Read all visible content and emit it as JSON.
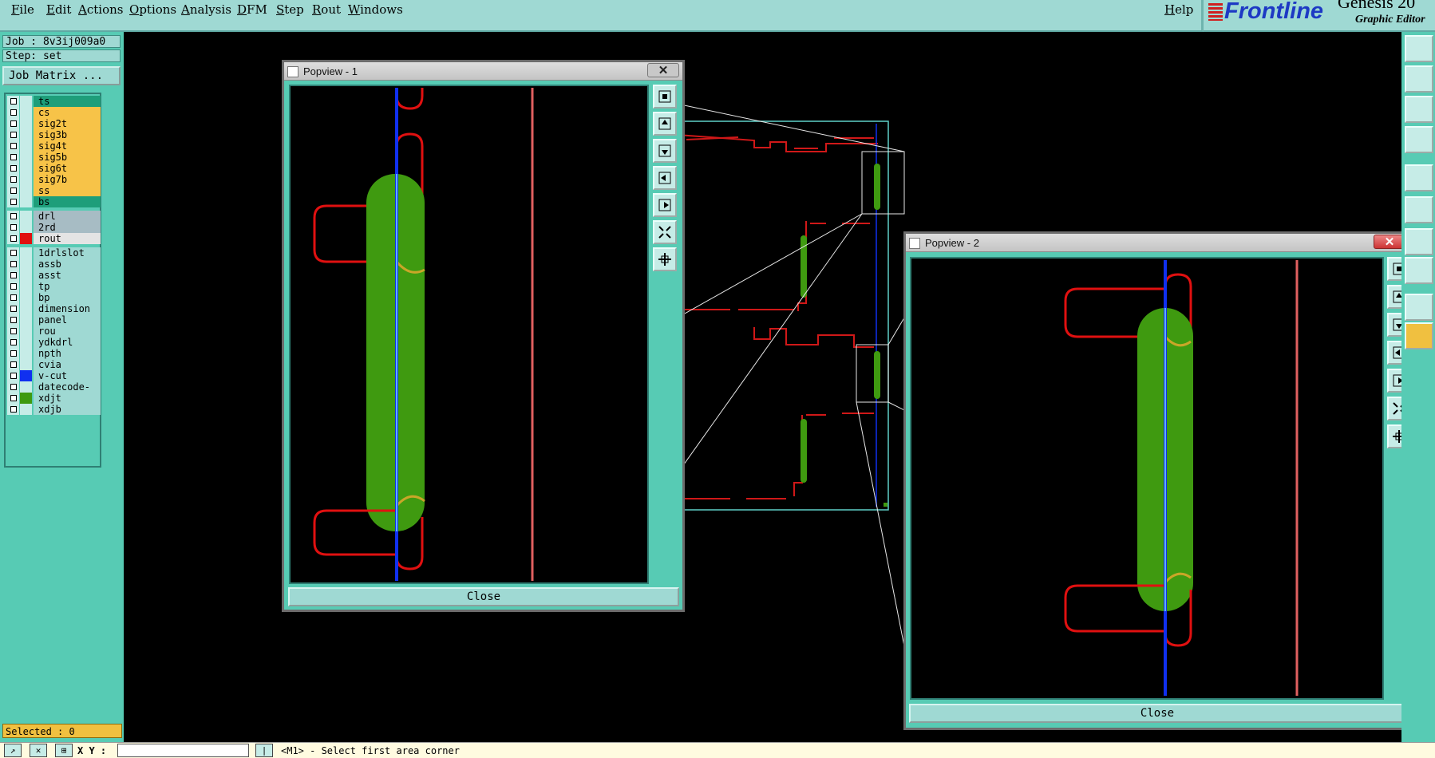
{
  "menubar": {
    "items": [
      "File",
      "Edit",
      "Actions",
      "Options",
      "Analysis",
      "DFM",
      "Step",
      "Rout",
      "Windows"
    ],
    "help": "Help"
  },
  "brand": {
    "logo": "Frontline",
    "product": "Genesis 20",
    "subtitle": "Graphic Editor"
  },
  "left": {
    "job": "Job : 8v3ij009a0",
    "step": "Step: set",
    "job_matrix": "Job Matrix ...",
    "layers": [
      {
        "name": "ts",
        "color": "#1e9e7a",
        "swatch": ""
      },
      {
        "name": "cs",
        "color": "#f7c348",
        "swatch": ""
      },
      {
        "name": "sig2t",
        "color": "#f7c348",
        "swatch": ""
      },
      {
        "name": "sig3b",
        "color": "#f7c348",
        "swatch": ""
      },
      {
        "name": "sig4t",
        "color": "#f7c348",
        "swatch": ""
      },
      {
        "name": "sig5b",
        "color": "#f7c348",
        "swatch": ""
      },
      {
        "name": "sig6t",
        "color": "#f7c348",
        "swatch": ""
      },
      {
        "name": "sig7b",
        "color": "#f7c348",
        "swatch": ""
      },
      {
        "name": "ss",
        "color": "#f7c348",
        "swatch": ""
      },
      {
        "name": "bs",
        "color": "#1e9e7a",
        "swatch": ""
      },
      {
        "name": "drl",
        "color": "#a7bcc4",
        "swatch": ""
      },
      {
        "name": "2rd",
        "color": "#a7bcc4",
        "swatch": ""
      },
      {
        "name": "rout",
        "color": "#e4e4e4",
        "swatch": "#e01010"
      },
      {
        "name": "1drlslot",
        "color": "#9fd9d3",
        "swatch": ""
      },
      {
        "name": "assb",
        "color": "#9fd9d3",
        "swatch": ""
      },
      {
        "name": "asst",
        "color": "#9fd9d3",
        "swatch": ""
      },
      {
        "name": "tp",
        "color": "#9fd9d3",
        "swatch": ""
      },
      {
        "name": "bp",
        "color": "#9fd9d3",
        "swatch": ""
      },
      {
        "name": "dimension",
        "color": "#9fd9d3",
        "swatch": ""
      },
      {
        "name": "panel",
        "color": "#9fd9d3",
        "swatch": ""
      },
      {
        "name": "rou",
        "color": "#9fd9d3",
        "swatch": ""
      },
      {
        "name": "ydkdrl",
        "color": "#9fd9d3",
        "swatch": ""
      },
      {
        "name": "npth",
        "color": "#9fd9d3",
        "swatch": ""
      },
      {
        "name": "cvia",
        "color": "#9fd9d3",
        "swatch": ""
      },
      {
        "name": "v-cut",
        "color": "#9fd9d3",
        "swatch": "#1030f0"
      },
      {
        "name": "datecode-bs",
        "color": "#9fd9d3",
        "swatch": ""
      },
      {
        "name": "xdjt",
        "color": "#9fd9d3",
        "swatch": "#3f9a10"
      },
      {
        "name": "xdjb",
        "color": "#9fd9d3",
        "swatch": ""
      }
    ],
    "selected": "Selected : 0"
  },
  "popview1": {
    "title": "Popview - 1",
    "close_label": "Close"
  },
  "popview2": {
    "title": "Popview - 2",
    "close_label": "Close"
  },
  "bottom": {
    "xy_label": "X Y :",
    "xy_value": "",
    "status": "<M1> - Select first area corner"
  },
  "colors": {
    "panel": "#57cbb4",
    "light": "#9fd9d3",
    "rout": "#e01010",
    "vcut": "#1030f0",
    "xdjt": "#3f9a10",
    "copper": "#f7c348"
  }
}
